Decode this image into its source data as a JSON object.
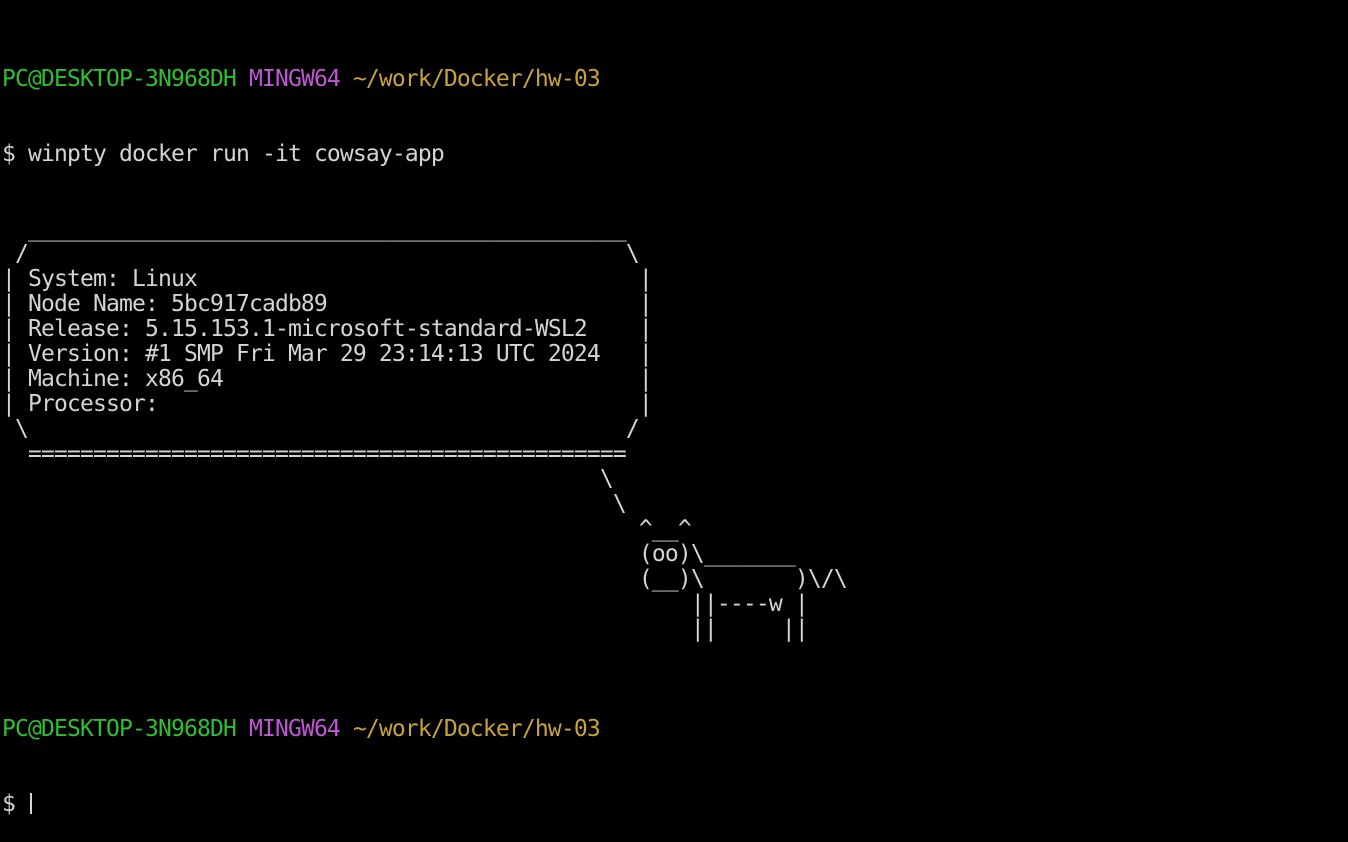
{
  "prompt": {
    "user_host": "PC@DESKTOP-3N968DH",
    "system": "MINGW64",
    "path": "~/work/Docker/hw-03",
    "symbol": "$"
  },
  "command": "winpty docker run -it cowsay-app",
  "output_lines": [
    "  ______________________________________________",
    " /                                              \\",
    "| System: Linux                                  |",
    "| Node Name: 5bc917cadb89                        |",
    "| Release: 5.15.153.1-microsoft-standard-WSL2    |",
    "| Version: #1 SMP Fri Mar 29 23:14:13 UTC 2024   |",
    "| Machine: x86_64                                |",
    "| Processor:                                     |",
    " \\                                              /",
    "  ==============================================",
    "                                              \\",
    "                                               \\",
    "                                                 ^__^",
    "                                                 (oo)\\_______",
    "                                                 (__)\\       )\\/\\",
    "                                                     ||----w |",
    "                                                     ||     ||",
    ""
  ],
  "colors": {
    "background": "#000000",
    "text": "#d4d4d4",
    "user_host": "#2ec02e",
    "system": "#c157d6",
    "path": "#c8a33a"
  }
}
